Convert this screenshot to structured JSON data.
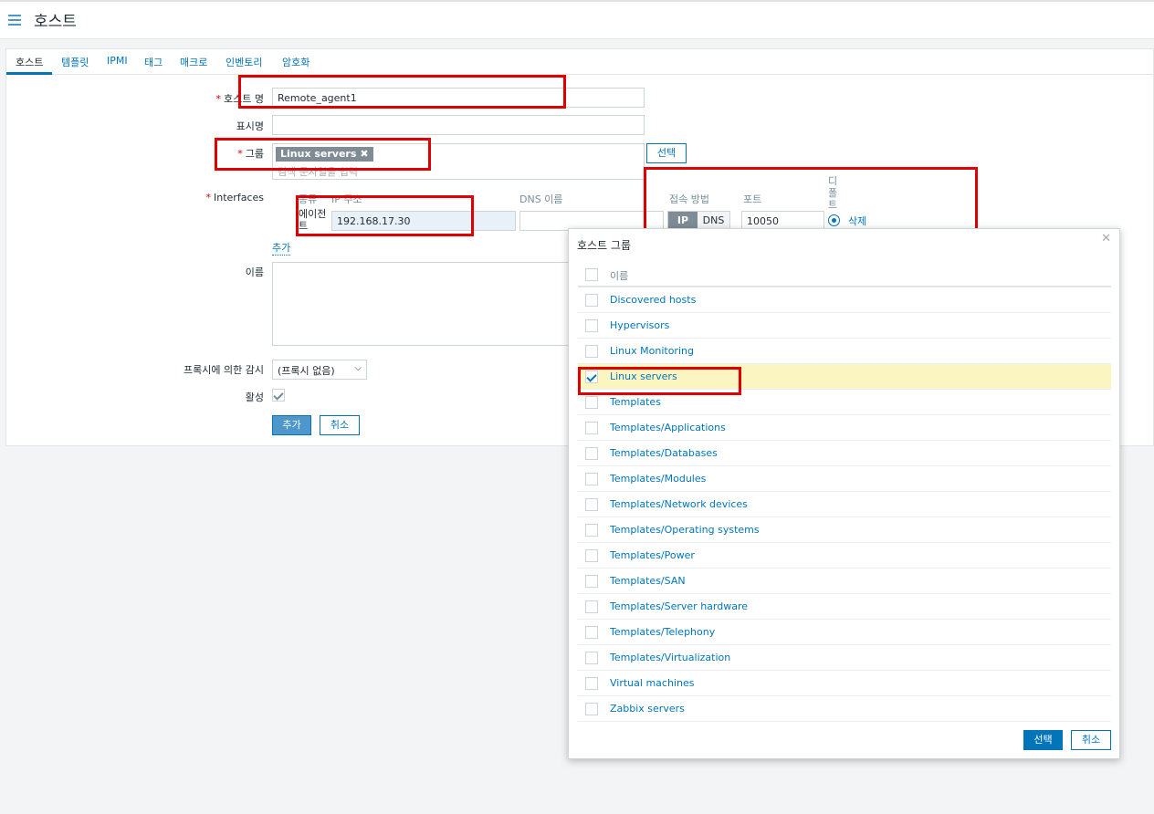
{
  "header": {
    "title": "호스트"
  },
  "tabs": [
    "호스트",
    "템플릿",
    "IPMI",
    "태그",
    "매크로",
    "인벤토리",
    "암호화"
  ],
  "form": {
    "host_name_label": "호스트 명",
    "host_name_value": "Remote_agent1",
    "display_name_label": "표시명",
    "display_name_value": "",
    "groups_label": "그룹",
    "group_chip": "Linux servers",
    "group_placeholder": "검색 문자열을 입력",
    "select_button": "선택",
    "interfaces_label": "Interfaces",
    "iface_cols": {
      "type": "종류",
      "ip": "IP 주소",
      "dns": "DNS 이름",
      "connect": "접속 방법",
      "port": "포트",
      "default": "디폴트"
    },
    "iface_row": {
      "type": "에이전트",
      "ip": "192.168.17.30",
      "dns": "",
      "conn_ip": "IP",
      "conn_dns": "DNS",
      "port": "10050",
      "remove": "삭제"
    },
    "add_link": "추가",
    "description_label": "이름",
    "proxy_label": "프록시에 의한 감시",
    "proxy_value": "(프록시 없음)",
    "enabled_label": "활성",
    "add_button": "추가",
    "cancel_button": "취소"
  },
  "modal": {
    "title": "호스트 그룹",
    "header_col": "이름",
    "groups": [
      {
        "name": "Discovered hosts",
        "checked": false
      },
      {
        "name": "Hypervisors",
        "checked": false
      },
      {
        "name": "Linux Monitoring",
        "checked": false
      },
      {
        "name": "Linux servers",
        "checked": true
      },
      {
        "name": "Templates",
        "checked": false
      },
      {
        "name": "Templates/Applications",
        "checked": false
      },
      {
        "name": "Templates/Databases",
        "checked": false
      },
      {
        "name": "Templates/Modules",
        "checked": false
      },
      {
        "name": "Templates/Network devices",
        "checked": false
      },
      {
        "name": "Templates/Operating systems",
        "checked": false
      },
      {
        "name": "Templates/Power",
        "checked": false
      },
      {
        "name": "Templates/SAN",
        "checked": false
      },
      {
        "name": "Templates/Server hardware",
        "checked": false
      },
      {
        "name": "Templates/Telephony",
        "checked": false
      },
      {
        "name": "Templates/Virtualization",
        "checked": false
      },
      {
        "name": "Virtual machines",
        "checked": false
      },
      {
        "name": "Zabbix servers",
        "checked": false
      }
    ],
    "select_button": "선택",
    "cancel_button": "취소"
  },
  "colors": {
    "accent": "#0275b8",
    "highlight": "#e00000",
    "selected_row": "#fbf5c2"
  }
}
